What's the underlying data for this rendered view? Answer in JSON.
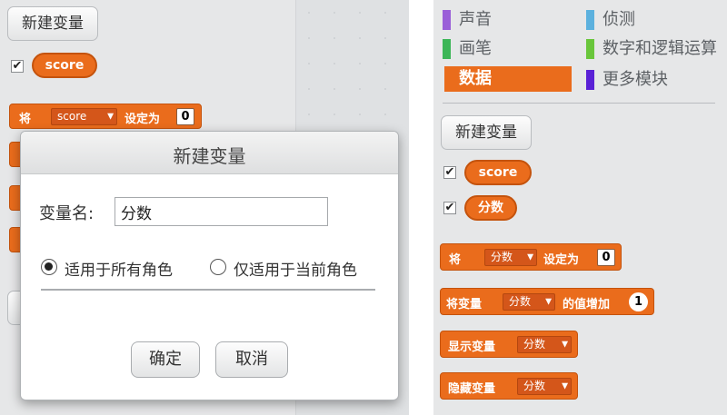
{
  "left": {
    "new_variable_button": "新建变量",
    "score_reporter": "score",
    "set_block": {
      "label": "将",
      "variable": "score",
      "suffix": "设定为",
      "value": "0"
    }
  },
  "dialog": {
    "title": "新建变量",
    "name_label": "变量名:",
    "name_value": "分数",
    "radio_all_sprites": "适用于所有角色",
    "radio_this_sprite": "仅适用于当前角色",
    "selected_scope": "all_sprites",
    "ok_label": "确定",
    "cancel_label": "取消"
  },
  "right": {
    "categories": [
      {
        "label": "声音",
        "color": "#9a5fd8"
      },
      {
        "label": "侦测",
        "color": "#5cb1de"
      },
      {
        "label": "画笔",
        "color": "#3cb657"
      },
      {
        "label": "数字和逻辑运算",
        "color": "#69c63b"
      },
      {
        "label": "数据",
        "color": "#ea6c1c",
        "selected": true
      },
      {
        "label": "更多模块",
        "color": "#5a21d6"
      }
    ],
    "new_variable_button": "新建变量",
    "reporters": [
      "score",
      "分数"
    ],
    "set_block": {
      "label": "将",
      "variable": "分数",
      "suffix": "设定为",
      "value": "0"
    },
    "change_block": {
      "prefix": "将变量",
      "variable": "分数",
      "suffix": "的值增加",
      "value": "1"
    },
    "show_block": {
      "label": "显示变量",
      "variable": "分数"
    },
    "hide_block": {
      "label": "隐藏变量",
      "variable": "分数"
    }
  },
  "colors": {
    "data_orange": "#ea6c1c",
    "palette_bg": "#e6e7e8"
  }
}
